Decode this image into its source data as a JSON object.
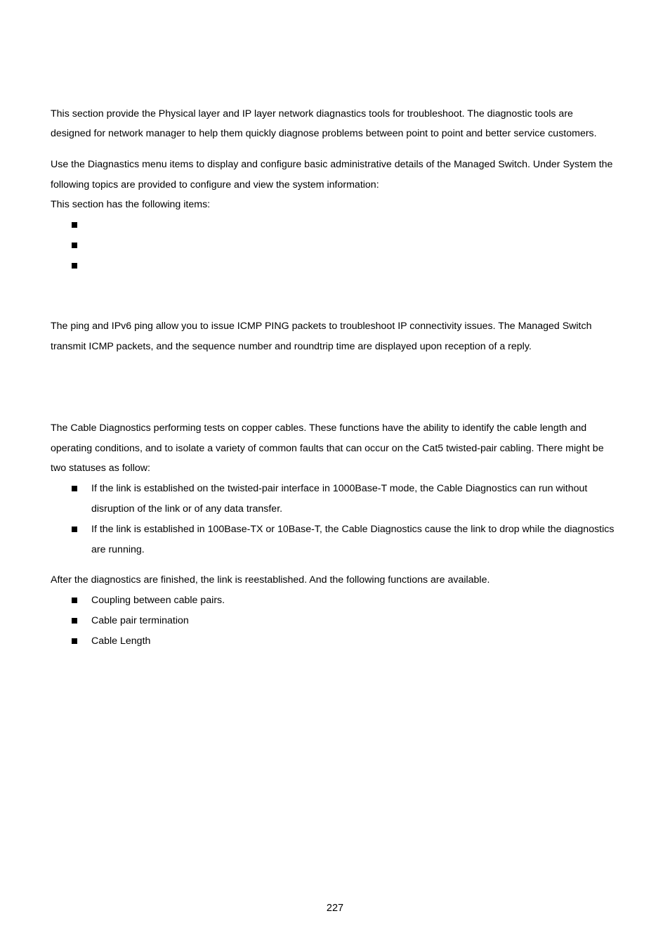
{
  "document": {
    "intro": {
      "lines": [
        "This section provide the Physical layer and IP layer network diagnastics tools for troubleshoot. The diagnostic tools are",
        "designed for network manager to help them quickly diagnose problems between point to point and better service customers."
      ]
    },
    "menu_description": {
      "lines": [
        "Use the Diagnastics menu items to display and configure basic administrative details of the Managed Switch. Under System the",
        "following topics are provided to configure and view the system information:",
        "This section has the following items:"
      ]
    },
    "section_items": [
      "",
      "",
      ""
    ],
    "ping": {
      "lines": [
        "The ping and IPv6 ping allow you to issue ICMP PING packets to troubleshoot IP connectivity issues. The Managed Switch",
        "transmit ICMP packets, and the sequence number and roundtrip time are displayed upon reception of a reply."
      ]
    },
    "cable_diagnostics": {
      "lines": [
        "The Cable Diagnostics performing tests on copper cables. These functions have the ability to identify the cable length and",
        "operating conditions, and to isolate a variety of common faults that can occur on the Cat5 twisted-pair cabling. There might be",
        "two statuses as follow:"
      ],
      "statuses": [
        {
          "lines": [
            "If the link is established on the twisted-pair interface in 1000Base-T mode, the Cable Diagnostics can run without",
            "disruption of the link or of any data transfer."
          ]
        },
        {
          "lines": [
            "If the link is established in 100Base-TX or 10Base-T, the Cable Diagnostics cause the link to drop while the diagnostics",
            "are running."
          ]
        }
      ],
      "after_text": "After the diagnostics are finished, the link is reestablished. And the following functions are available.",
      "functions": [
        "Coupling between cable pairs.",
        "Cable pair termination",
        "Cable Length"
      ]
    },
    "page_number": "227"
  }
}
